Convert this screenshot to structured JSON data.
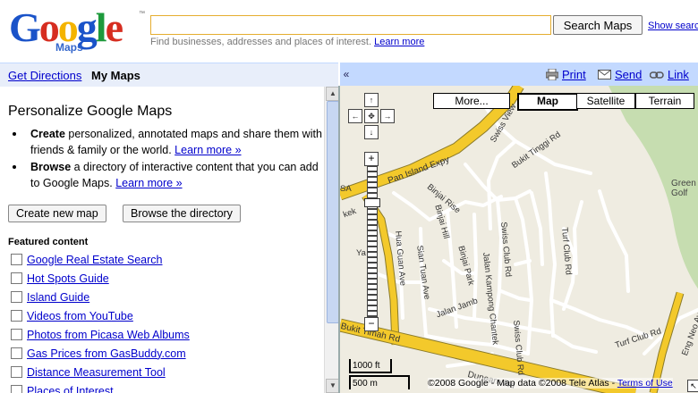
{
  "header": {
    "logo_text": "Google",
    "logo_sub": "Maps",
    "logo_tm": "™",
    "search_value": "",
    "search_button": "Search Maps",
    "show_search_options": "Show search",
    "hint_text": "Find businesses, addresses and places of interest.",
    "hint_link": "Learn more"
  },
  "nav": {
    "get_directions": "Get Directions",
    "my_maps": "My Maps",
    "collapse_glyph": "«",
    "print": "Print",
    "send": "Send",
    "link": "Link"
  },
  "panel": {
    "title": "Personalize Google Maps",
    "bullet1_bold": "Create",
    "bullet1_text": " personalized, annotated maps and share them with friends & family or the world. ",
    "bullet1_link": "Learn more »",
    "bullet2_bold": "Browse",
    "bullet2_text": " a directory of interactive content that you can add to Google Maps. ",
    "bullet2_link": "Learn more »",
    "create_button": "Create new map",
    "browse_button": "Browse the directory",
    "featured_title": "Featured content",
    "featured": [
      "Google Real Estate Search",
      "Hot Spots Guide",
      "Island Guide",
      "Videos from YouTube",
      "Photos from Picasa Web Albums",
      "Gas Prices from GasBuddy.com",
      "Distance Measurement Tool",
      "Places of Interest"
    ]
  },
  "map": {
    "more_button": "More...",
    "type_map": "Map",
    "type_satellite": "Satellite",
    "type_terrain": "Terrain",
    "labels": {
      "pan_island": "Pan Island Expy",
      "bukit_tinggi": "Bukit Tinggi Rd",
      "swiss_view": "Swiss View",
      "binjai_rise": "Binjai Rise",
      "binjai_hill": "Binjai Hill",
      "binjai_park": "Binjai Park",
      "hua_guan": "Hua Guan Ave",
      "sian_tuan": "Sian Tuan Ave",
      "jalan_kampong": "Jalan Kampong Chantek",
      "swiss_club_1": "Swiss Club Rd",
      "swiss_club_2": "Swiss Club Rd",
      "turf_club_1": "Turf Club Rd",
      "turf_club_2": "Turf Club Rd",
      "dunearn": "Dunearn Rd",
      "bukit_timah": "Bukit Timah Rd",
      "eng_neo": "Eng Neo Ave",
      "green_golf": "Green Golf",
      "jalan_jamb": "Jalan Jamb",
      "ya": "Ya",
      "kek": "kek",
      "sa": "SA"
    },
    "scale_ft": "1000 ft",
    "scale_m": "500 m",
    "copyright": "©2008 Google - Map data ©2008 Tele Atlas - ",
    "terms": "Terms of Use"
  },
  "colors": {
    "nav_bg": "#c3d9ff",
    "highway": "#f3c92b",
    "park": "#c6ddb0",
    "map_bg": "#efece1",
    "link": "#0000cc"
  }
}
